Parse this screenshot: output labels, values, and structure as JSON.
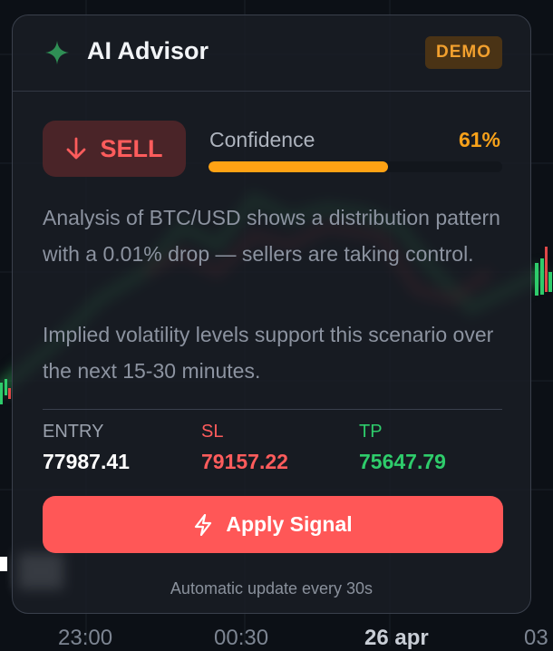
{
  "background": {
    "time_labels": [
      "23:00",
      "00:30",
      "26 apr",
      "03"
    ]
  },
  "advisor": {
    "title": "AI Advisor",
    "badge": "DEMO",
    "signal": {
      "direction": "SELL",
      "direction_icon": "arrow-down-icon",
      "color": "#ff5c5c"
    },
    "confidence": {
      "label": "Confidence",
      "value_text": "61%",
      "value": 0.61,
      "color": "#ffa214"
    },
    "analysis": [
      "Analysis of BTC/USD shows a distribution pattern with a 0.01% drop — sellers are taking control.",
      "Implied volatility levels support this scenario over the next 15-30 minutes."
    ],
    "levels": {
      "entry": {
        "label": "ENTRY",
        "value": "77987.41"
      },
      "sl": {
        "label": "SL",
        "value": "79157.22"
      },
      "tp": {
        "label": "TP",
        "value": "75647.79"
      }
    },
    "apply_button": {
      "label": "Apply Signal",
      "icon": "lightning-icon",
      "color": "#ff5757"
    },
    "footer": "Automatic update every 30s"
  }
}
